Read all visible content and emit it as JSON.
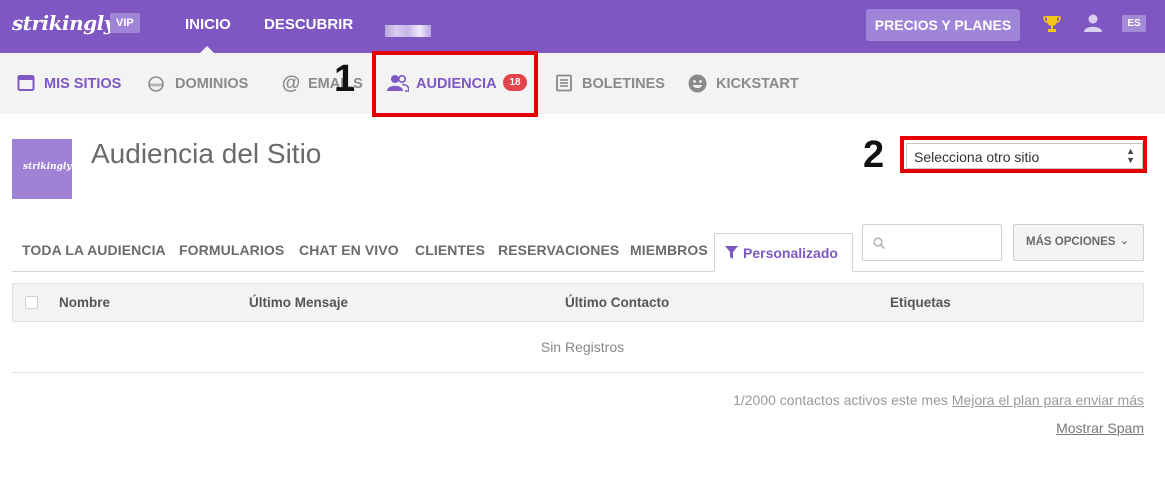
{
  "topbar": {
    "logo": "strikingly",
    "vip": "VIP",
    "nav": [
      "INICIO",
      "DESCUBRIR"
    ],
    "pricing": "PRECIOS Y PLANES",
    "lang": "ES",
    "color": "#7e57c2"
  },
  "subnav": {
    "items": [
      {
        "label": "MIS SITIOS",
        "icon": "browser-window-icon",
        "active": true
      },
      {
        "label": "DOMINIOS",
        "icon": "www-icon",
        "active": false
      },
      {
        "label": "EMAILS",
        "icon": "at-icon",
        "active": false
      },
      {
        "label": "AUDIENCIA",
        "icon": "users-icon",
        "active": true,
        "badge": "18"
      },
      {
        "label": "BOLETINES",
        "icon": "newsletter-icon",
        "active": false
      },
      {
        "label": "KICKSTART",
        "icon": "smiley-icon",
        "active": false
      }
    ]
  },
  "annotations": {
    "one": "1",
    "two": "2",
    "color": "#e50000"
  },
  "header": {
    "thumb_text": "strikingly",
    "title": "Audiencia del Sitio",
    "site_select": "Selecciona otro sitio"
  },
  "tabs": {
    "items": [
      "TODA LA AUDIENCIA",
      "FORMULARIOS",
      "CHAT EN VIVO",
      "CLIENTES",
      "RESERVACIONES",
      "MIEMBROS"
    ],
    "active": "Personalizado"
  },
  "search": {
    "placeholder": ""
  },
  "more_options": "MÁS OPCIONES",
  "table": {
    "columns": [
      "Nombre",
      "Último Mensaje",
      "Último Contacto",
      "Etiquetas"
    ],
    "empty": "Sin Registros"
  },
  "footer": {
    "contacts": "1/2000 contactos activos este mes",
    "upgrade": "Mejora el plan para enviar más",
    "spam": "Mostrar Spam"
  }
}
